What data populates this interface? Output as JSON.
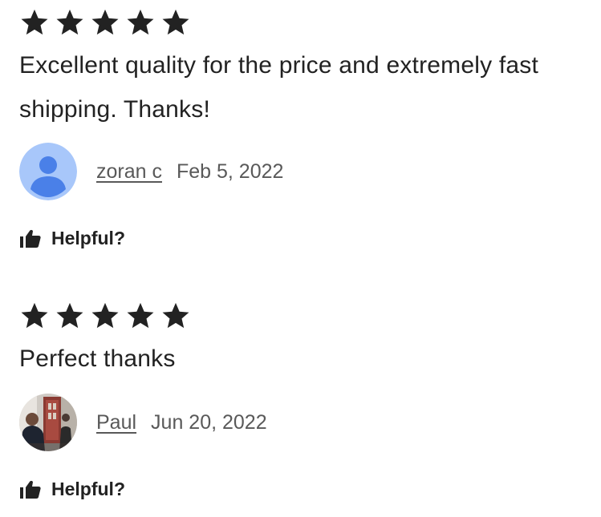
{
  "reviews": [
    {
      "rating": 5,
      "text": "Excellent quality for the price and extremely fast shipping. Thanks!",
      "author": "zoran c",
      "date": "Feb 5, 2022",
      "avatar": "default-person-avatar",
      "helpful_label": "Helpful?"
    },
    {
      "rating": 5,
      "text": "Perfect thanks",
      "author": "Paul",
      "date": "Jun 20, 2022",
      "avatar": "photo-avatar",
      "helpful_label": "Helpful?"
    }
  ],
  "colors": {
    "text": "#222222",
    "meta_text": "#595959",
    "star": "#222222",
    "default_avatar_bg": "#a8c7fa",
    "default_avatar_figure": "#4a80e8"
  },
  "icons": {
    "star": "star-icon",
    "helpful": "thumbs-up-icon"
  }
}
